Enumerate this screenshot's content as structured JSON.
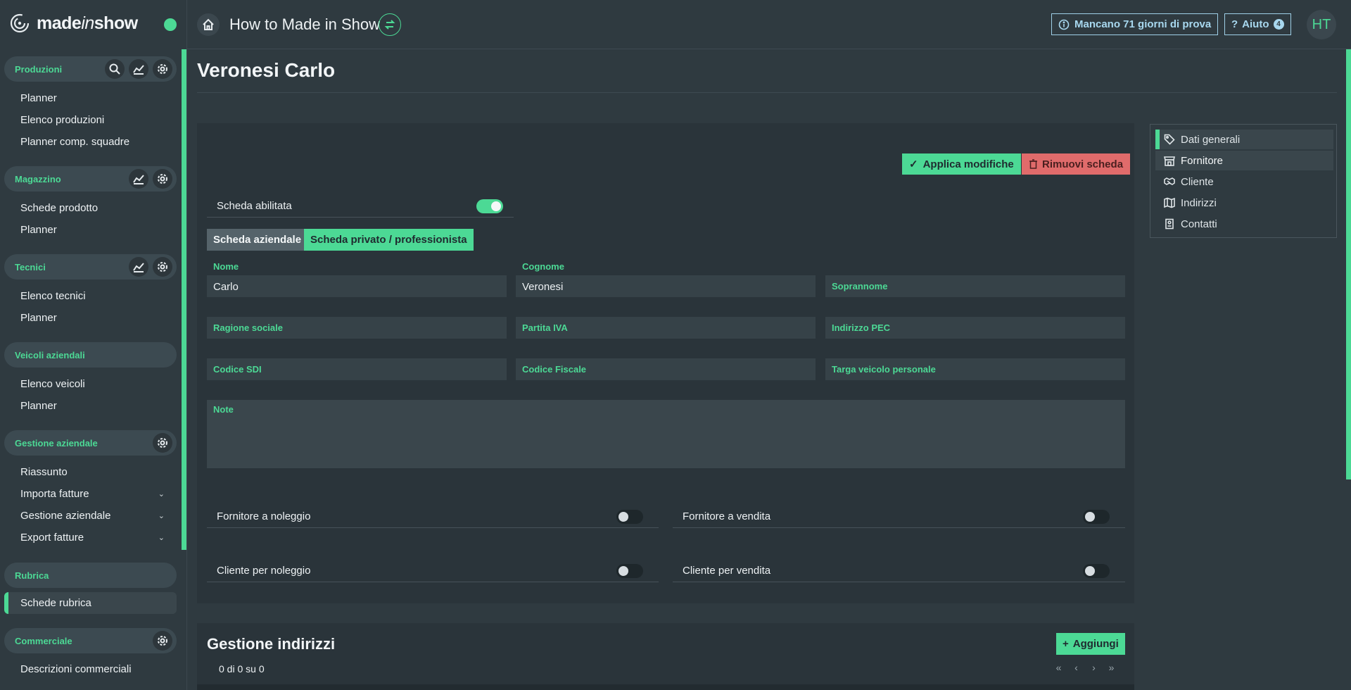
{
  "app": {
    "logo_prefix": "made",
    "logo_italic": "in",
    "logo_suffix": "show",
    "title": "How to Made in Show"
  },
  "topbar": {
    "trial_label": "Mancano 71 giorni di prova",
    "help_label": "Aiuto",
    "help_count": "4",
    "avatar_initials": "HT"
  },
  "sidebar": {
    "sections": [
      {
        "label": "Produzioni",
        "items": [
          "Planner",
          "Elenco produzioni",
          "Planner comp. squadre"
        ]
      },
      {
        "label": "Magazzino",
        "items": [
          "Schede prodotto",
          "Planner"
        ]
      },
      {
        "label": "Tecnici",
        "items": [
          "Elenco tecnici",
          "Planner"
        ]
      },
      {
        "label": "Veicoli aziendali",
        "items": [
          "Elenco veicoli",
          "Planner"
        ]
      },
      {
        "label": "Gestione aziendale",
        "items": [
          "Riassunto",
          "Importa fatture",
          "Gestione aziendale",
          "Export fatture"
        ]
      },
      {
        "label": "Rubrica",
        "items": [
          "Schede rubrica"
        ]
      },
      {
        "label": "Commerciale",
        "items": [
          "Descrizioni commerciali"
        ]
      }
    ]
  },
  "page": {
    "title": "Veronesi Carlo"
  },
  "form": {
    "apply_label": "Applica modifiche",
    "remove_label": "Rimuovi scheda",
    "enabled_label": "Scheda abilitata",
    "enabled": true,
    "tab_company": "Scheda aziendale",
    "tab_private": "Scheda privato / professionista",
    "fields": {
      "nome": {
        "label": "Nome",
        "value": "Carlo"
      },
      "cognome": {
        "label": "Cognome",
        "value": "Veronesi"
      },
      "soprannome": {
        "placeholder": "Soprannome"
      },
      "ragione_sociale": {
        "placeholder": "Ragione sociale"
      },
      "partita_iva": {
        "placeholder": "Partita IVA"
      },
      "pec": {
        "placeholder": "Indirizzo PEC"
      },
      "sdi": {
        "placeholder": "Codice SDI"
      },
      "codice_fiscale": {
        "placeholder": "Codice Fiscale"
      },
      "targa": {
        "placeholder": "Targa veicolo personale"
      },
      "note": {
        "placeholder": "Note"
      }
    },
    "toggles": [
      {
        "label": "Fornitore a noleggio",
        "on": false
      },
      {
        "label": "Fornitore a vendita",
        "on": false
      },
      {
        "label": "Cliente per noleggio",
        "on": false
      },
      {
        "label": "Cliente per vendita",
        "on": false
      }
    ]
  },
  "side_tabs": [
    "Dati generali",
    "Fornitore",
    "Cliente",
    "Indirizzi",
    "Contatti"
  ],
  "addresses": {
    "title": "Gestione indirizzi",
    "add_label": "Aggiungi",
    "count_text": "0 di 0 su 0"
  },
  "colors": {
    "accent": "#4cd995",
    "danger": "#e06b6b",
    "info": "#a8d8ef",
    "background": "#2f3a40"
  }
}
